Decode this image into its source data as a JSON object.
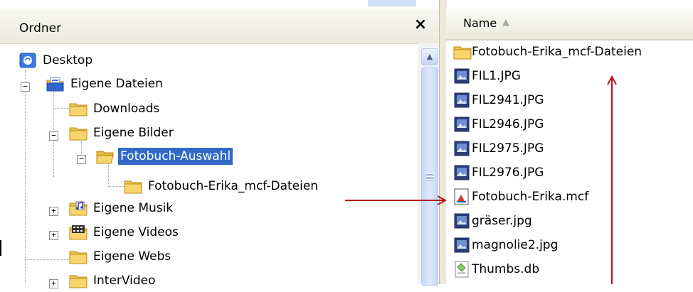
{
  "folders_pane": {
    "title": "Ordner",
    "close_label": "×",
    "tree": [
      {
        "id": "desktop",
        "label": "Desktop",
        "icon": "desktop-icon",
        "expander": ""
      },
      {
        "id": "eigene-dateien",
        "label": "Eigene Dateien",
        "icon": "my-documents-icon",
        "expander": "−"
      },
      {
        "id": "downloads",
        "label": "Downloads",
        "icon": "folder-icon",
        "expander": ""
      },
      {
        "id": "eigene-bilder",
        "label": "Eigene Bilder",
        "icon": "folder-icon",
        "expander": "−"
      },
      {
        "id": "fotobuch-auswahl",
        "label": "Fotobuch-Auswahl",
        "icon": "folder-open-icon",
        "expander": "−",
        "selected": true
      },
      {
        "id": "fotobuch-erika-mcf",
        "label": "Fotobuch-Erika_mcf-Dateien",
        "icon": "folder-icon",
        "expander": ""
      },
      {
        "id": "eigene-musik",
        "label": "Eigene Musik",
        "icon": "music-folder-icon",
        "expander": "+"
      },
      {
        "id": "eigene-videos",
        "label": "Eigene Videos",
        "icon": "video-folder-icon",
        "expander": "+"
      },
      {
        "id": "eigene-webs",
        "label": "Eigene Webs",
        "icon": "folder-icon",
        "expander": ""
      },
      {
        "id": "intervideo",
        "label": "InterVideo",
        "icon": "folder-icon",
        "expander": "+"
      }
    ]
  },
  "files_pane": {
    "column_name": "Name",
    "sort_indicator": "▲",
    "files": [
      {
        "label": "Fotobuch-Erika_mcf-Dateien",
        "icon": "folder-icon"
      },
      {
        "label": "FIL1.JPG",
        "icon": "image-file-icon"
      },
      {
        "label": "FIL2941.JPG",
        "icon": "image-file-icon"
      },
      {
        "label": "FIL2946.JPG",
        "icon": "image-file-icon"
      },
      {
        "label": "FIL2975.JPG",
        "icon": "image-file-icon"
      },
      {
        "label": "FIL2976.JPG",
        "icon": "image-file-icon"
      },
      {
        "label": "Fotobuch-Erika.mcf",
        "icon": "mcf-file-icon"
      },
      {
        "label": "gräser.jpg",
        "icon": "image-file-icon"
      },
      {
        "label": "magnolie2.jpg",
        "icon": "image-file-icon"
      },
      {
        "label": "Thumbs.db",
        "icon": "db-file-icon"
      }
    ]
  },
  "colors": {
    "selection": "#316ac5",
    "annotation_arrow": "#b3121b",
    "folder_yellow": "#f5c542"
  }
}
